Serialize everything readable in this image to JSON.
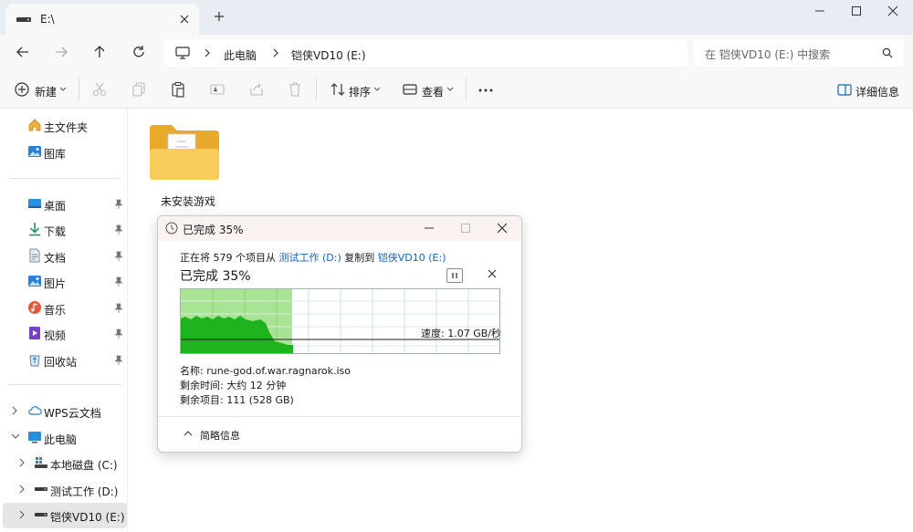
{
  "tab": {
    "title": "E:\\"
  },
  "address": {
    "crumbs": [
      "此电脑",
      "铠侠VD10 (E:)"
    ],
    "search_placeholder": "在 铠侠VD10 (E:) 中搜索"
  },
  "toolbar": {
    "new_label": "新建",
    "sort_label": "排序",
    "view_label": "查看",
    "details_label": "详细信息"
  },
  "sidebar": {
    "quick": [
      {
        "label": "主文件夹",
        "icon": "home-icon"
      },
      {
        "label": "图库",
        "icon": "gallery-icon"
      }
    ],
    "pinned": [
      {
        "label": "桌面",
        "icon": "desktop-icon"
      },
      {
        "label": "下载",
        "icon": "download-icon"
      },
      {
        "label": "文档",
        "icon": "document-icon"
      },
      {
        "label": "图片",
        "icon": "pictures-icon"
      },
      {
        "label": "音乐",
        "icon": "music-icon"
      },
      {
        "label": "视频",
        "icon": "video-icon"
      },
      {
        "label": "回收站",
        "icon": "recycle-bin-icon"
      }
    ],
    "tree": [
      {
        "label": "WPS云文档",
        "icon": "cloud-icon"
      },
      {
        "label": "此电脑",
        "icon": "computer-icon"
      },
      {
        "label": "本地磁盘 (C:)",
        "icon": "windows-drive-icon"
      },
      {
        "label": "测试工作 (D:)",
        "icon": "drive-icon"
      },
      {
        "label": "铠侠VD10 (E:)",
        "icon": "drive-icon"
      }
    ]
  },
  "content": {
    "folder_name": "未安装游戏"
  },
  "dialog": {
    "title": "已完成 35%",
    "line_prefix": "正在将 579 个项目从 ",
    "source": "测试工作 (D:)",
    "line_mid": " 复制到 ",
    "dest": "铠侠VD10 (E:)",
    "percent_label": "已完成 35%",
    "progress": 0.35,
    "speed": "速度: 1.07 GB/秒",
    "name": "名称: rune-god.of.war.ragnarok.iso",
    "time_left": "剩余时间: 大约 12 分钟",
    "items_left": "剩余项目: 111 (528 GB)",
    "brief_label": "简略信息"
  },
  "colors": {
    "accent": "#1563c0",
    "progress_fill": "#a8e493",
    "graph_fill": "#1fb41f",
    "folder": "#f5c954"
  }
}
